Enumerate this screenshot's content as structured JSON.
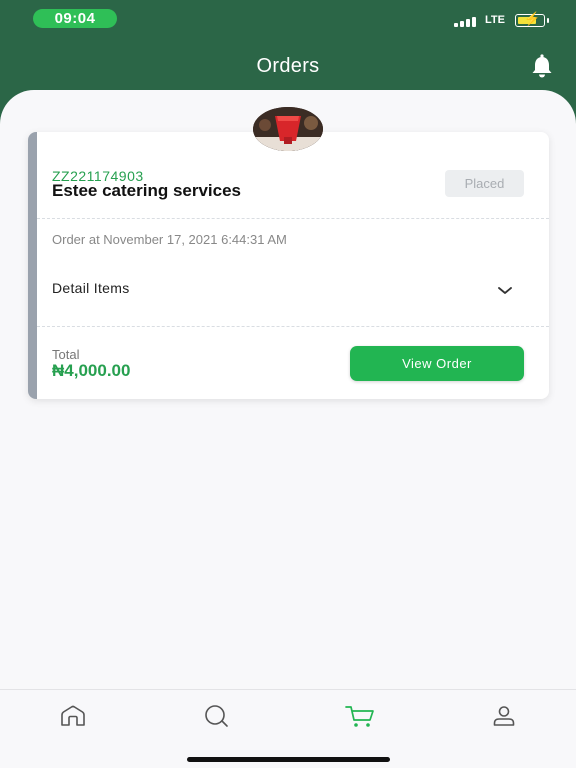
{
  "status_bar": {
    "time": "09:04",
    "network": "LTE",
    "icons": [
      "signal-icon",
      "battery-icon",
      "charging-bolt-icon"
    ]
  },
  "header": {
    "title": "Orders",
    "action_icon": "bell-icon"
  },
  "colors": {
    "brand_dark": "#2b6647",
    "accent_green": "#22b552",
    "code_green": "#27a050",
    "card_accent": "#9aa2ad"
  },
  "order": {
    "code": "ZZ221174903",
    "vendor": "Estee catering services",
    "status": "Placed",
    "date": "Order at November 17, 2021 6:44:31 AM",
    "details_label": "Detail Items",
    "total_label": "Total",
    "total_value": "₦4,000.00",
    "view_button": "View Order"
  },
  "bottom_nav": {
    "items": [
      {
        "icon": "home-icon",
        "active": false
      },
      {
        "icon": "chat-icon",
        "active": false
      },
      {
        "icon": "cart-icon",
        "active": true
      },
      {
        "icon": "profile-icon",
        "active": false
      }
    ]
  }
}
